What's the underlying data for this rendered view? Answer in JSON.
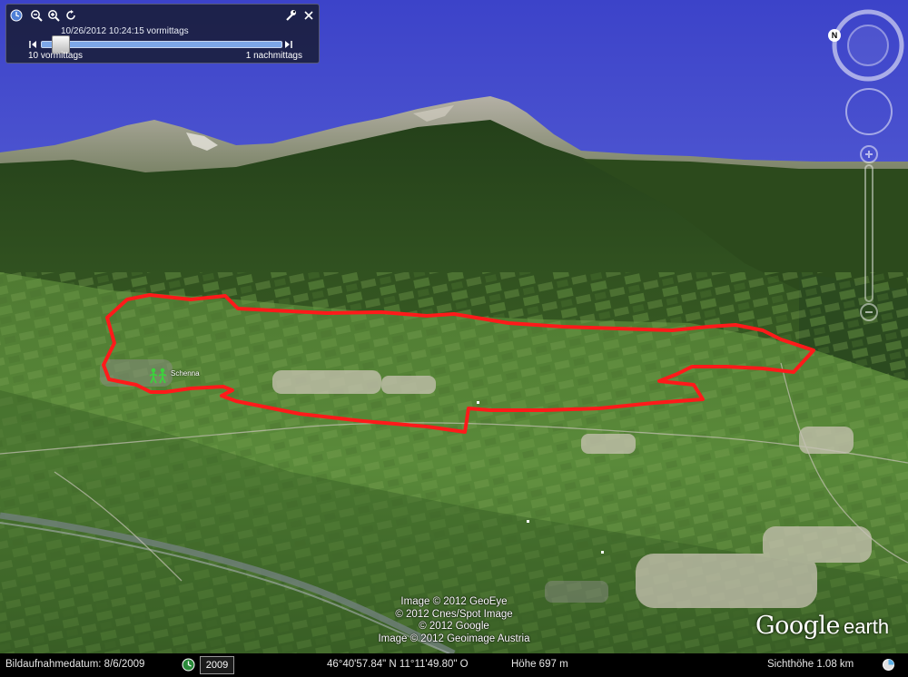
{
  "timeline": {
    "datetime": "10/26/2012   10:24:15 vormittags",
    "start_label": "10 vormittags",
    "end_label": "1 nachmittags",
    "position": 0.05
  },
  "toolbar": {
    "icons": [
      "clock-icon",
      "zoom-out-icon",
      "zoom-in-icon",
      "reset-icon",
      "wrench-icon",
      "close-icon"
    ]
  },
  "navigation": {
    "north_label": "N"
  },
  "placemark": {
    "label": "Schenna"
  },
  "credits": [
    "Image © 2012 GeoEye",
    "© 2012 Cnes/Spot Image",
    "© 2012 Google",
    "Image © 2012 Geoimage Austria"
  ],
  "brand": {
    "google": "Google",
    "earth": "earth"
  },
  "statusbar": {
    "imagery_date": "Bildaufnahmedatum: 8/6/2009",
    "year": "2009",
    "coordinates": "46°40'57.84\" N   11°11'49.80\" O",
    "elevation": "Höhe   697 m",
    "eye_altitude": "Sichthöhe    1.08 km"
  },
  "colors": {
    "track": "#ff1a1a",
    "sky": "#5c64d6",
    "panel": "#141828"
  }
}
